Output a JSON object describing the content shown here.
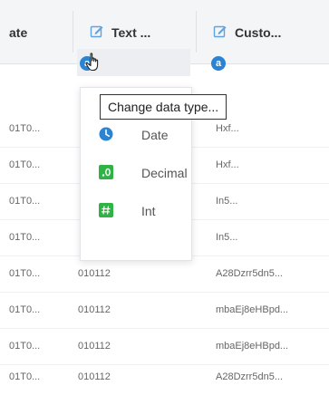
{
  "columns": {
    "date": "ate",
    "text": "Text ...",
    "custom": "Custo..."
  },
  "type_badges": {
    "text": "a",
    "custom": "a"
  },
  "rows": [
    {
      "c1": "01T0...",
      "c2": "",
      "c3": "Hxf..."
    },
    {
      "c1": "01T0...",
      "c2": "",
      "c3": "Hxf..."
    },
    {
      "c1": "01T0...",
      "c2": "",
      "c3": "In5..."
    },
    {
      "c1": "01T0...",
      "c2": "",
      "c3": "In5..."
    },
    {
      "c1": "01T0...",
      "c2": "010112",
      "c3": "A28Dzrr5dn5..."
    },
    {
      "c1": "01T0...",
      "c2": "010112",
      "c3": "mbaEj8eHBpd..."
    },
    {
      "c1": "01T0...",
      "c2": "010112",
      "c3": "mbaEj8eHBpd..."
    },
    {
      "c1": "01T0...",
      "c2": "010112",
      "c3": "A28Dzrr5dn5..."
    }
  ],
  "menu": {
    "tooltip": "Change data type...",
    "items": [
      {
        "label": "Date",
        "icon": "clock-icon",
        "color": "#2b83d4"
      },
      {
        "label": "Decimal",
        "icon": "decimal-icon",
        "color": "#2fb344"
      },
      {
        "label": "Int",
        "icon": "int-icon",
        "color": "#2fb344"
      }
    ]
  },
  "colors": {
    "accent_blue": "#2b83d4",
    "accent_green": "#2fb344",
    "header_bg": "#f4f5f7"
  }
}
